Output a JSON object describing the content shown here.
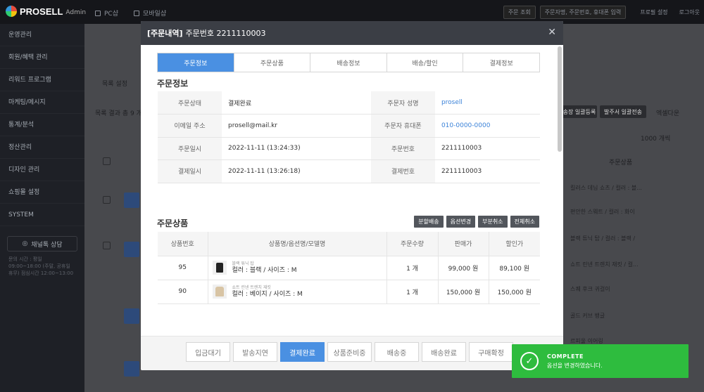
{
  "app": {
    "brand": "PROSELL",
    "brand_sub": "Admin"
  },
  "topbar": {
    "nav": [
      "PC샵",
      "모바일샵"
    ],
    "right": [
      "주문 조회",
      "주문자명, 주문번호, 휴대폰 입력",
      "프로필 설정",
      "로그아웃"
    ]
  },
  "sidebar": {
    "items": [
      "운영관리",
      "회원/혜택 관리",
      "리워드 프로그램",
      "마케팅/메시지",
      "통계/분석",
      "정산관리",
      "디자인 관리",
      "쇼핑몰 설정",
      "SYSTEM"
    ],
    "kakao_label": "채널톡 상담",
    "note": "문의 시간 : 평일 09:00~18:00 (주말, 공휴일 휴무)\n점심시간 12:00~13:00"
  },
  "background": {
    "list_setting": "목록 설정",
    "result_text": "목록 결과 총 9 개",
    "btn_bulk_register": "송장 일괄등록",
    "btn_bulk_send": "발주서 일괄전송",
    "btn_excel": "엑셀다운",
    "per_page": "1000 개씩",
    "col_product": "주문상품",
    "rows": [
      "킬러스 데님 쇼츠 / 컬러 : 블...",
      "편안한 스웨트 / 컬러 : 화이",
      "블랙 튜닉 탑 / 컬러 : 블랙 /",
      "쇼트 린넨 트렌치 재킷 / 컬...",
      "스퀘 후크 귀걸이",
      "골드 커브 뱅글",
      "르피울 이어링"
    ]
  },
  "modal": {
    "title_strong": "[주문내역]",
    "title_rest": "주문번호 2211110003",
    "tabs": [
      "주문정보",
      "주문상품",
      "배송정보",
      "배송/할인",
      "결제정보"
    ],
    "order_info_title": "주문정보",
    "info_rows": [
      {
        "l1": "주문상태",
        "v1": "결제완료",
        "l2": "주문자 성명",
        "v2": "prosell"
      },
      {
        "l1": "이메일 주소",
        "v1": "prosell@mail.kr",
        "l2": "주문자 휴대폰",
        "v2": "010-0000-0000"
      },
      {
        "l1": "주문일시",
        "v1": "2022-11-11 (13:24:33)",
        "l2": "주문번호",
        "v2": "2211110003"
      },
      {
        "l1": "결제일시",
        "v1": "2022-11-11 (13:26:18)",
        "l2": "결제번호",
        "v2": "2211110003"
      }
    ],
    "products_title": "주문상품",
    "product_actions": [
      "분할배송",
      "옵션변경",
      "부분취소",
      "전체취소"
    ],
    "product_headers": [
      "상품번호",
      "상품명/옵션명/모델명",
      "주문수량",
      "판매가",
      "할인가"
    ],
    "products": [
      {
        "id": "95",
        "name": "블랙 튜닉 탑",
        "option": "컬러 : 블랙 / 사이즈 : M",
        "qty": "1 개",
        "price": "99,000 원",
        "sale": "89,100 원"
      },
      {
        "id": "90",
        "name": "쇼트 린넨 트렌치 재킷",
        "option": "컬러 : 베이지 / 사이즈 : M",
        "qty": "1 개",
        "price": "150,000 원",
        "sale": "150,000 원"
      }
    ],
    "status_buttons": [
      "입금대기",
      "발송지연",
      "결제완료",
      "상품준비중",
      "배송중",
      "배송완료",
      "구매확정"
    ],
    "active_status": "결제완료"
  },
  "toast": {
    "title": "COMPLETE",
    "message": "옵션을 변경하였습니다."
  },
  "colors": {
    "accent": "#4a90e2",
    "toast": "#2ebc3e",
    "modal_header": "#3b3e45",
    "link": "#3b82d8"
  }
}
